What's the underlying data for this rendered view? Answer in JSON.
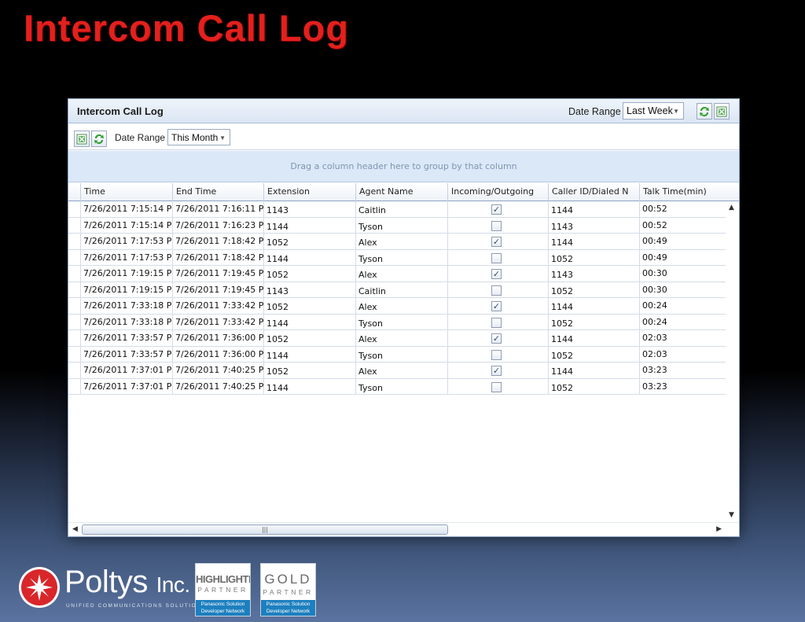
{
  "slide": {
    "title": "Intercom Call Log"
  },
  "window": {
    "title": "Intercom Call Log",
    "date_range_label": "Date Range",
    "date_range_value": "Last Week"
  },
  "toolbar": {
    "date_range_label": "Date Range",
    "date_range_value": "This Month"
  },
  "group_panel": {
    "hint": "Drag a column header here to group by that column"
  },
  "grid": {
    "columns": [
      "Time",
      "End Time",
      "Extension",
      "Agent Name",
      "Incoming/Outgoing",
      "Caller ID/Dialed N",
      "Talk Time(min)"
    ],
    "rows": [
      {
        "time": "7/26/2011 7:15:14 P",
        "end": "7/26/2011 7:16:11 P",
        "ext": "1143",
        "agent": "Caitlin",
        "incoming": true,
        "caller": "1144",
        "talk": "00:52"
      },
      {
        "time": "7/26/2011 7:15:14 P",
        "end": "7/26/2011 7:16:23 P",
        "ext": "1144",
        "agent": "Tyson",
        "incoming": false,
        "caller": "1143",
        "talk": "00:52"
      },
      {
        "time": "7/26/2011 7:17:53 P",
        "end": "7/26/2011 7:18:42 P",
        "ext": "1052",
        "agent": "Alex",
        "incoming": true,
        "caller": "1144",
        "talk": "00:49"
      },
      {
        "time": "7/26/2011 7:17:53 P",
        "end": "7/26/2011 7:18:42 P",
        "ext": "1144",
        "agent": "Tyson",
        "incoming": false,
        "caller": "1052",
        "talk": "00:49"
      },
      {
        "time": "7/26/2011 7:19:15 P",
        "end": "7/26/2011 7:19:45 P",
        "ext": "1052",
        "agent": "Alex",
        "incoming": true,
        "caller": "1143",
        "talk": "00:30"
      },
      {
        "time": "7/26/2011 7:19:15 P",
        "end": "7/26/2011 7:19:45 P",
        "ext": "1143",
        "agent": "Caitlin",
        "incoming": false,
        "caller": "1052",
        "talk": "00:30"
      },
      {
        "time": "7/26/2011 7:33:18 P",
        "end": "7/26/2011 7:33:42 P",
        "ext": "1052",
        "agent": "Alex",
        "incoming": true,
        "caller": "1144",
        "talk": "00:24"
      },
      {
        "time": "7/26/2011 7:33:18 P",
        "end": "7/26/2011 7:33:42 P",
        "ext": "1144",
        "agent": "Tyson",
        "incoming": false,
        "caller": "1052",
        "talk": "00:24"
      },
      {
        "time": "7/26/2011 7:33:57 P",
        "end": "7/26/2011 7:36:00 P",
        "ext": "1052",
        "agent": "Alex",
        "incoming": true,
        "caller": "1144",
        "talk": "02:03"
      },
      {
        "time": "7/26/2011 7:33:57 P",
        "end": "7/26/2011 7:36:00 P",
        "ext": "1144",
        "agent": "Tyson",
        "incoming": false,
        "caller": "1052",
        "talk": "02:03"
      },
      {
        "time": "7/26/2011 7:37:01 P",
        "end": "7/26/2011 7:40:25 P",
        "ext": "1052",
        "agent": "Alex",
        "incoming": true,
        "caller": "1144",
        "talk": "03:23"
      },
      {
        "time": "7/26/2011 7:37:01 P",
        "end": "7/26/2011 7:40:25 P",
        "ext": "1144",
        "agent": "Tyson",
        "incoming": false,
        "caller": "1052",
        "talk": "03:23"
      }
    ]
  },
  "footer": {
    "brand_name": "Poltys",
    "brand_suffix": "Inc.",
    "tagline": "UNIFIED COMMUNICATIONS SOLUTIONS",
    "badges": [
      {
        "top": "HIGHLIGHTED",
        "sub": "PARTNER",
        "foot1": "Panasonic Solution",
        "foot2": "Developer Network"
      },
      {
        "top": "GOLD",
        "sub": "PARTNER",
        "foot1": "Panasonic Solution",
        "foot2": "Developer Network"
      }
    ]
  },
  "colors": {
    "title_red": "#e3201d",
    "header_blue": "#dbe8f7",
    "badge_blue": "#1d7fbf"
  }
}
